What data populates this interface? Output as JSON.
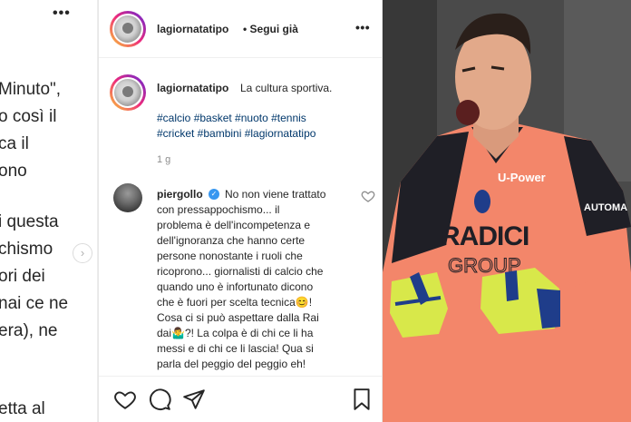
{
  "left_panel": {
    "lines": [
      "Minuto\",",
      "o così il",
      "ca il",
      "ono",
      "i questa",
      "chismo",
      "ori dei",
      "nai ce ne",
      "era), ne",
      "etta al"
    ],
    "more_icon": "more-horizontal-icon",
    "next_icon": "chevron-right-icon"
  },
  "post": {
    "username": "lagiornatatipo",
    "follow_label": "• Segui già",
    "more_icon": "more-horizontal-icon",
    "caption": {
      "username": "lagiornatatipo",
      "text": "La cultura sportiva.",
      "hashtags_line1": "#calcio #basket #nuoto #tennis",
      "hashtags_line2": "#cricket #bambini #lagiornatatipo",
      "time": "1 g"
    },
    "comment": {
      "username": "piergollo",
      "verified_icon": "verified-badge-icon",
      "lines": [
        "No non viene trattato",
        "con pressappochismo... il",
        "problema è dell'incompetenza e",
        "dell'ignoranza che hanno certe",
        "persone nonostante i ruoli che",
        "ricoprono... giornalisti di calcio che",
        "quando uno è infortunato dicono",
        "che è fuori per scelta tecnica😊!",
        "Cosa ci si può aspettare dalla Rai",
        "dai🤷‍♂️?! La colpa è di chi ce li ha",
        "messi e di chi ce li lascia! Qua si",
        "parla del peggio del peggio eh!"
      ],
      "like_icon": "heart-icon"
    },
    "actions": {
      "like_icon": "heart-icon",
      "comment_icon": "comment-icon",
      "share_icon": "send-icon",
      "save_icon": "bookmark-icon"
    }
  },
  "photo": {
    "sponsor_text_1": "RADICI",
    "sponsor_text_2": "GROUP",
    "chest_sponsor": "U-Power",
    "sleeve_sponsor": "AUTOMA",
    "colors": {
      "jersey": "#f3866a",
      "gloves": "#d8e84a",
      "dark": "#1f1f26"
    }
  }
}
